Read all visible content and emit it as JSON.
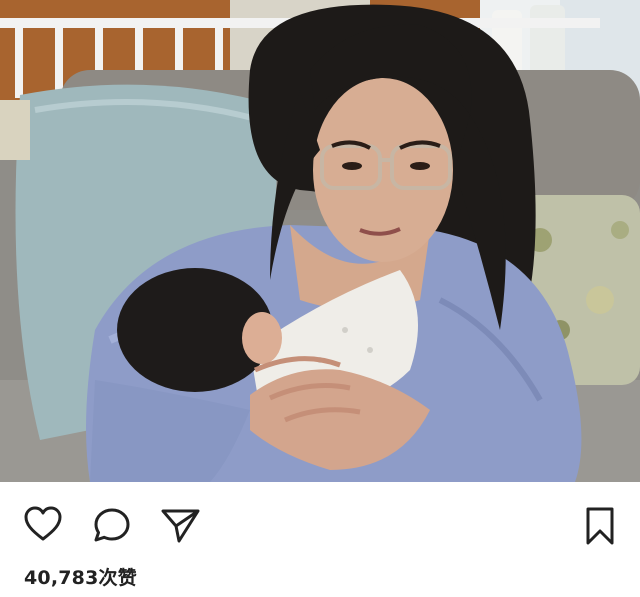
{
  "post": {
    "likes_text": "40,783次赞"
  },
  "actions": {
    "like_icon": "heart-icon",
    "comment_icon": "comment-bubble-icon",
    "share_icon": "paper-plane-icon",
    "save_icon": "bookmark-icon"
  },
  "colors": {
    "icon_stroke": "#222222",
    "background": "#ffffff"
  }
}
